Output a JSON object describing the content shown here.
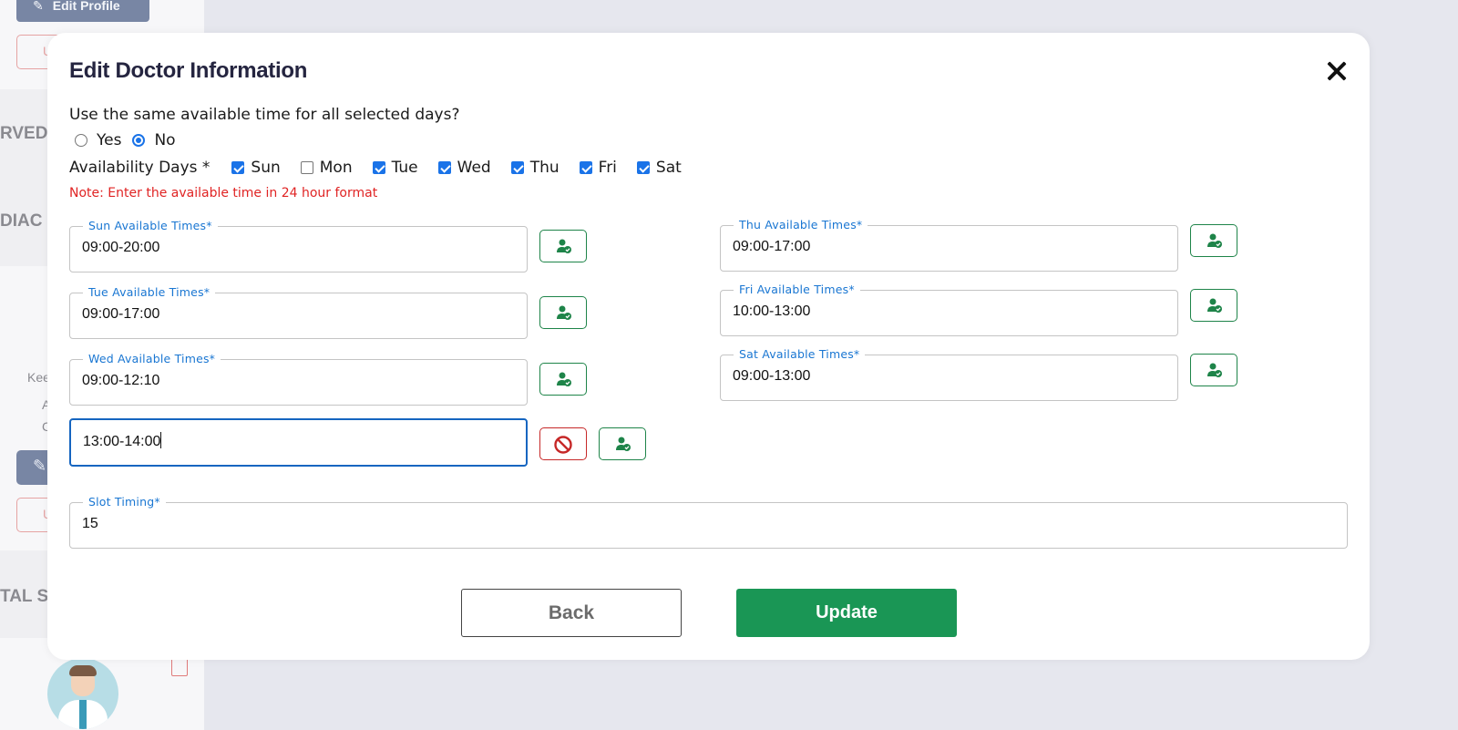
{
  "background": {
    "edit_profile_label": "Edit Profile",
    "outline_btn_letter": "U",
    "fragment_served": "RVED",
    "fragment_cardiac": "DIAC",
    "fragment_kee": "Kee",
    "fragment_a": "A",
    "fragment_c": "C",
    "fragment_total": "TAL S"
  },
  "modal": {
    "title": "Edit Doctor Information",
    "question": "Use the same available time for all selected days?",
    "radio": {
      "yes": "Yes",
      "no": "No",
      "selected": "No"
    },
    "days_label": "Availability Days *",
    "days": [
      {
        "label": "Sun",
        "checked": true
      },
      {
        "label": "Mon",
        "checked": false
      },
      {
        "label": "Tue",
        "checked": true
      },
      {
        "label": "Wed",
        "checked": true
      },
      {
        "label": "Thu",
        "checked": true
      },
      {
        "label": "Fri",
        "checked": true
      },
      {
        "label": "Sat",
        "checked": true
      }
    ],
    "note": "Note: Enter the available time in 24 hour format",
    "left_fields": [
      {
        "label": "Sun Available Times*",
        "value": "09:00-20:00"
      },
      {
        "label": "Tue Available Times*",
        "value": "09:00-17:00"
      },
      {
        "label": "Wed Available Times*",
        "value": "09:00-12:10"
      }
    ],
    "extra_wed_value": "13:00-14:00",
    "right_fields": [
      {
        "label": "Thu Available Times*",
        "value": "09:00-17:00"
      },
      {
        "label": "Fri Available Times*",
        "value": "10:00-13:00"
      },
      {
        "label": "Sat Available Times*",
        "value": "09:00-13:00"
      }
    ],
    "slot": {
      "label": "Slot Timing*",
      "value": "15"
    },
    "back_label": "Back",
    "update_label": "Update"
  },
  "colors": {
    "primary": "#1a9655",
    "accent_blue": "#1a73e8",
    "danger": "#c62828",
    "note_red": "#e02424"
  },
  "icons": {
    "add_slot": "users-check-icon",
    "remove_slot": "ban-icon",
    "close": "close-icon"
  }
}
